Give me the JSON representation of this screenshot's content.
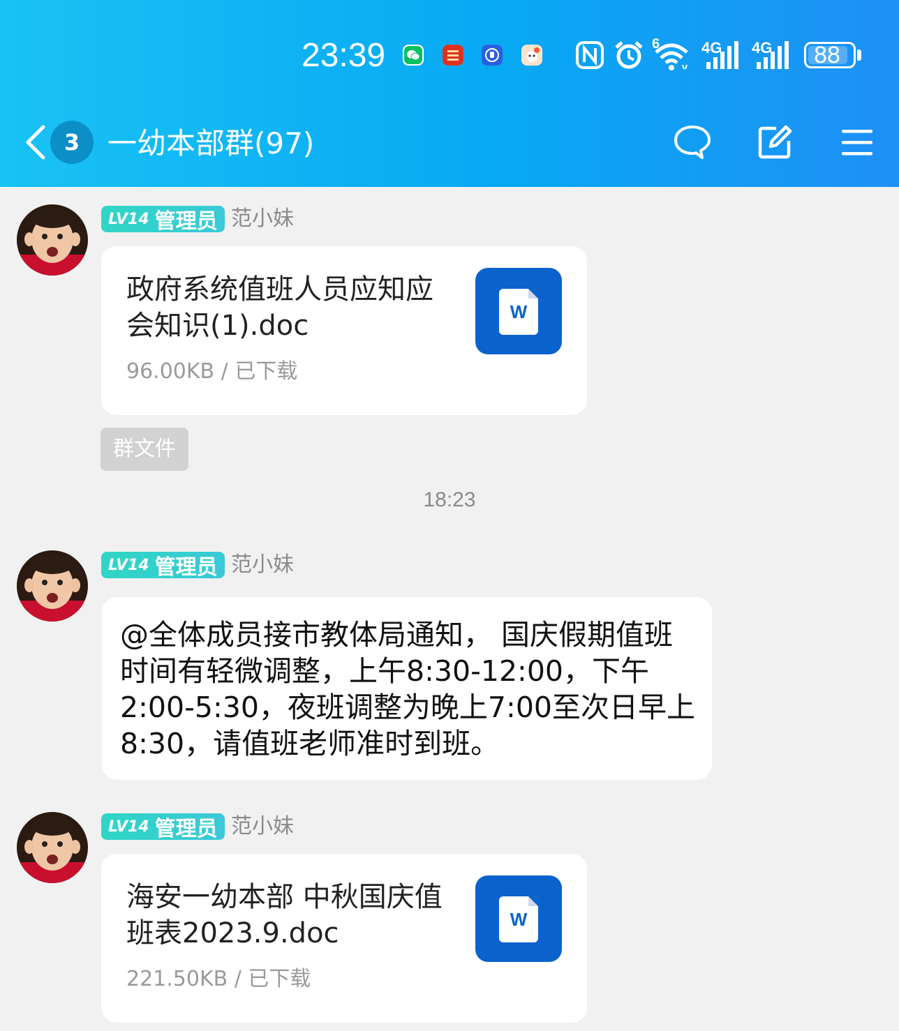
{
  "status_bar": {
    "time": "23:39",
    "app_icons": [
      "wechat-icon",
      "pingan-bank-icon",
      "hand-app-icon",
      "cartoon-app-icon"
    ],
    "network_6": "6",
    "network_4g_1": "4G",
    "network_4g_2": "4G",
    "battery": "88"
  },
  "header": {
    "unread_count": "3",
    "title": "一幼本部群(97)"
  },
  "messages": [
    {
      "level": "LV14",
      "role": "管理员",
      "sender": "范小妹",
      "file_name": "政府系统值班人员应知应会知识(1).doc",
      "file_meta": "96.00KB / 已下载",
      "doc_letter": "W"
    },
    {
      "tag": "群文件",
      "timestamp": "18:23"
    },
    {
      "level": "LV14",
      "role": "管理员",
      "sender": "范小妹",
      "text": "@全体成员接市教体局通知， 国庆假期值班时间有轻微调整，上午8:30-12:00，下午2:00-5:30，夜班调整为晚上7:00至次日早上8:30，请值班老师准时到班。"
    },
    {
      "level": "LV14",
      "role": "管理员",
      "sender": "范小妹",
      "file_name": "海安一幼本部 中秋国庆值班表2023.9.doc",
      "file_meta": "221.50KB / 已下载",
      "doc_letter": "W"
    }
  ],
  "colors": {
    "header_start": "#19c2f4",
    "header_end": "#1e90f6",
    "badge": "#2fd6c4",
    "doc_icon": "#0a62cc",
    "background": "#f1f1f1"
  }
}
